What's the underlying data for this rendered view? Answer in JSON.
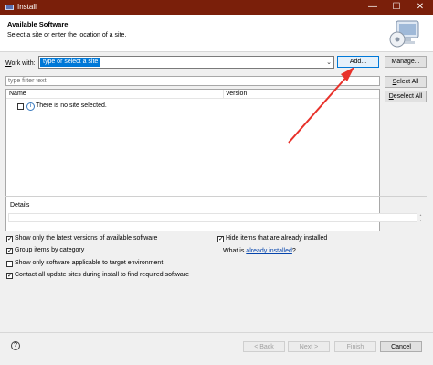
{
  "window": {
    "title": "Install",
    "minimize_glyph": "—",
    "maximize_glyph": "☐",
    "close_glyph": "✕"
  },
  "header": {
    "title": "Available Software",
    "description": "Select a site or enter the location of a site."
  },
  "work_with": {
    "label": "Work with:",
    "placeholder": "type or select a site",
    "add_label": "Add...",
    "manage_label": "Manage..."
  },
  "filter": {
    "placeholder": "type filter text",
    "select_all_label": "Select All",
    "deselect_all_label": "Deselect All"
  },
  "table": {
    "columns": [
      "Name",
      "Version"
    ],
    "message": "There is no site selected."
  },
  "details": {
    "label": "Details"
  },
  "options": {
    "latest_versions": {
      "label": "Show only the latest versions of available software",
      "checked": true
    },
    "group_by_category": {
      "label": "Group items by category",
      "checked": true
    },
    "target_env": {
      "label": "Show only software applicable to target environment",
      "checked": false
    },
    "contact_sites": {
      "label": "Contact all update sites during install to find required software",
      "checked": true
    },
    "hide_installed": {
      "label": "Hide items that are already installed",
      "checked": true
    },
    "what_is_prefix": "What is ",
    "what_is_link": "already installed",
    "what_is_suffix": "?"
  },
  "footer": {
    "help_glyph": "?",
    "back_label": "< Back",
    "next_label": "Next >",
    "finish_label": "Finish",
    "cancel_label": "Cancel"
  },
  "colors": {
    "titlebar": "#7a1f0a",
    "accent_arrow": "#e8312a",
    "selection": "#0078d7"
  }
}
